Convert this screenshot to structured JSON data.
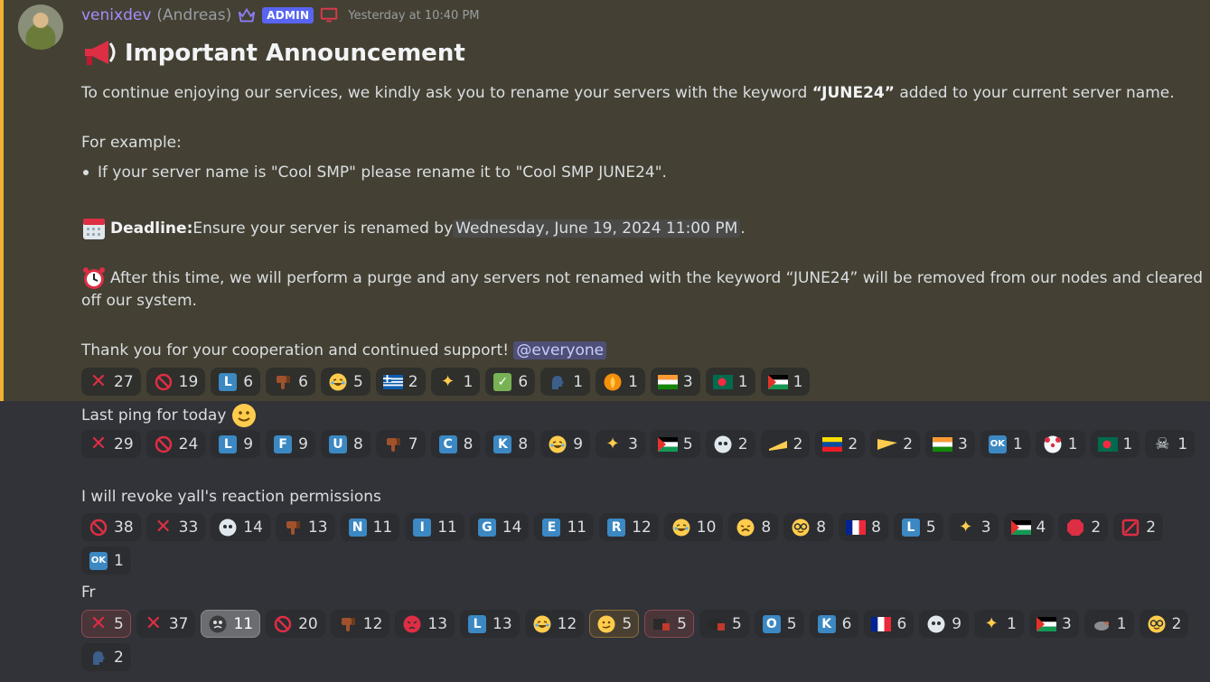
{
  "author": {
    "username": "venixdev",
    "realname": "(Andreas)",
    "badge": "ADMIN",
    "timestamp": "Yesterday at 10:40 PM"
  },
  "announcement": {
    "title_emoji": "megaphone-icon",
    "title": "Important Announcement",
    "p1_before": "To continue enjoying our services, we kindly ask you to rename your servers with the keyword ",
    "p1_keyword": "“JUNE24”",
    "p1_after": " added to your current server name.",
    "example_label": "For example:",
    "bullet": "If your server name is \"Cool SMP\" please rename it to \"Cool SMP JUNE24\".",
    "deadline_label": "Deadline:",
    "deadline_text": " Ensure your server is renamed by ",
    "deadline_date": "Wednesday, June 19, 2024 11:00 PM",
    "deadline_end": ".",
    "purge_line1": "After this time, we will perform a purge and any servers not renamed with the keyword “JUNE24” will be removed from our nodes and cleared",
    "purge_line2": "off our system.",
    "thanks": "Thank you for your cooperation and continued support! ",
    "mention": "@everyone"
  },
  "reactions1": [
    {
      "icon": "cross-mark-icon",
      "count": "27"
    },
    {
      "icon": "no-entry-icon",
      "count": "19"
    },
    {
      "icon": "letter-l-icon",
      "count": "6"
    },
    {
      "icon": "thumbs-down-icon",
      "count": "6"
    },
    {
      "icon": "rofl-icon",
      "count": "5"
    },
    {
      "icon": "flag-greece-icon",
      "count": "2"
    },
    {
      "icon": "sparkles-icon",
      "count": "1"
    },
    {
      "icon": "check-mark-icon",
      "count": "6"
    },
    {
      "icon": "speaking-head-icon",
      "count": "1"
    },
    {
      "icon": "fire-icon",
      "count": "1"
    },
    {
      "icon": "flag-india-icon",
      "count": "3"
    },
    {
      "icon": "flag-bangladesh-icon",
      "count": "1"
    },
    {
      "icon": "flag-palestine-icon",
      "count": "1"
    }
  ],
  "msg2": "Last ping for today",
  "reactions2": [
    {
      "icon": "cross-mark-icon",
      "count": "29"
    },
    {
      "icon": "no-entry-icon",
      "count": "24"
    },
    {
      "icon": "letter-l-icon",
      "count": "9"
    },
    {
      "icon": "letter-f-icon",
      "count": "9"
    },
    {
      "icon": "letter-u-icon",
      "count": "8"
    },
    {
      "icon": "thumbs-down-icon",
      "count": "7"
    },
    {
      "icon": "letter-c-icon",
      "count": "8"
    },
    {
      "icon": "letter-k-icon",
      "count": "8"
    },
    {
      "icon": "joy-icon",
      "count": "9"
    },
    {
      "icon": "sparkles-icon",
      "count": "3"
    },
    {
      "icon": "flag-palestine-icon",
      "count": "5"
    },
    {
      "icon": "skull-icon",
      "count": "2"
    },
    {
      "icon": "cheese-icon",
      "count": "2"
    },
    {
      "icon": "flag-ecuador-icon",
      "count": "2"
    },
    {
      "icon": "flag-custom-icon",
      "count": "2"
    },
    {
      "icon": "flag-india-icon",
      "count": "3"
    },
    {
      "icon": "ok-button-icon",
      "count": "1"
    },
    {
      "icon": "clown-icon",
      "count": "1"
    },
    {
      "icon": "flag-bangladesh-icon",
      "count": "1"
    },
    {
      "icon": "skull-crossbones-icon",
      "count": "1"
    }
  ],
  "msg3": "I will revoke yall's reaction permissions",
  "reactions3a": [
    {
      "icon": "no-entry-icon",
      "count": "38"
    },
    {
      "icon": "cross-mark-icon",
      "count": "33"
    },
    {
      "icon": "skull-icon",
      "count": "14"
    },
    {
      "icon": "thumbs-down-icon",
      "count": "13"
    },
    {
      "icon": "letter-n-icon",
      "count": "11"
    },
    {
      "icon": "letter-i-icon",
      "count": "11"
    },
    {
      "icon": "letter-g-icon",
      "count": "14"
    },
    {
      "icon": "letter-e-icon",
      "count": "11"
    },
    {
      "icon": "letter-r-icon",
      "count": "12"
    },
    {
      "icon": "rofl-icon",
      "count": "10"
    },
    {
      "icon": "weary-icon",
      "count": "8"
    },
    {
      "icon": "nerd-icon",
      "count": "8"
    },
    {
      "icon": "flag-france-icon",
      "count": "8"
    },
    {
      "icon": "letter-l-icon",
      "count": "5"
    },
    {
      "icon": "sparkles-icon",
      "count": "3"
    },
    {
      "icon": "flag-palestine-icon",
      "count": "4"
    },
    {
      "icon": "stop-sign-icon",
      "count": "2"
    },
    {
      "icon": "prohibited-icon",
      "count": "2"
    }
  ],
  "reactions3b": [
    {
      "icon": "ok-button-icon",
      "count": "1"
    }
  ],
  "msg4": "Fr",
  "reactions4a": [
    {
      "icon": "cross-mark-icon",
      "count": "5",
      "state": "active-red"
    },
    {
      "icon": "cross-mark-icon",
      "count": "37"
    },
    {
      "icon": "custom-face-icon",
      "count": "11",
      "state": "active-gray"
    },
    {
      "icon": "no-entry-icon",
      "count": "20"
    },
    {
      "icon": "thumbs-down-icon",
      "count": "12"
    },
    {
      "icon": "angry-icon",
      "count": "13"
    },
    {
      "icon": "letter-l-icon",
      "count": "13"
    },
    {
      "icon": "joy-icon",
      "count": "12"
    },
    {
      "icon": "smirk-cat-icon",
      "count": "5",
      "state": "active-gold"
    },
    {
      "icon": "custom-image-icon",
      "count": "5",
      "state": "active-red"
    },
    {
      "icon": "custom-image-icon",
      "count": "5"
    },
    {
      "icon": "letter-o-icon",
      "count": "5"
    },
    {
      "icon": "letter-k-icon",
      "count": "6"
    },
    {
      "icon": "flag-france-icon",
      "count": "6"
    },
    {
      "icon": "skull-icon",
      "count": "9"
    },
    {
      "icon": "sparkles-icon",
      "count": "1"
    },
    {
      "icon": "flag-palestine-icon",
      "count": "3"
    },
    {
      "icon": "rat-icon",
      "count": "1"
    },
    {
      "icon": "nerd-icon",
      "count": "2"
    }
  ],
  "reactions4b": [
    {
      "icon": "speaking-head-icon",
      "count": "2"
    }
  ]
}
